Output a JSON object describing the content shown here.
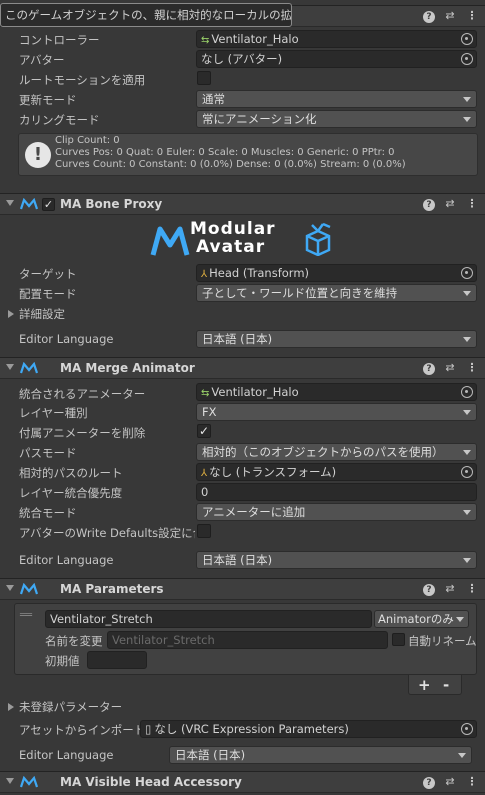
{
  "tooltip": "このゲームオブジェクトの、親に相対的なローカルの拡大縮小",
  "animator": {
    "controller_label": "コントローラー",
    "controller_value": "Ventilator_Halo",
    "avatar_label": "アバター",
    "avatar_value": "なし (アバター)",
    "root_motion_label": "ルートモーションを適用",
    "update_mode_label": "更新モード",
    "update_mode_value": "通常",
    "culling_label": "カリングモード",
    "culling_value": "常にアニメーション化",
    "info_lines": [
      "Clip Count: 0",
      "Curves Pos: 0 Quat: 0 Euler: 0 Scale: 0 Muscles: 0 Generic: 0 PPtr: 0",
      "Curves Count: 0 Constant: 0 (0.0%) Dense: 0 (0.0%) Stream: 0 (0.0%)"
    ]
  },
  "bone_proxy": {
    "title": "MA Bone Proxy",
    "logo_line1": "Modular",
    "logo_line2": "Avatar",
    "target_label": "ターゲット",
    "target_value": "Head (Transform)",
    "placement_label": "配置モード",
    "placement_value": "子として・ワールド位置と向きを維持",
    "advanced_label": "詳細設定",
    "language_label": "Editor Language",
    "language_value": "日本語 (日本)"
  },
  "merge_animator": {
    "title": "MA Merge Animator",
    "merged_label": "統合されるアニメーター",
    "merged_value": "Ventilator_Halo",
    "layer_type_label": "レイヤー種別",
    "layer_type_value": "FX",
    "delete_attached_label": "付属アニメーターを削除",
    "path_mode_label": "パスモード",
    "path_mode_value": "相対的（このオブジェクトからのパスを使用）",
    "relative_root_label": "相対的パスのルート",
    "relative_root_value": "なし (トランスフォーム)",
    "layer_priority_label": "レイヤー統合優先度",
    "layer_priority_value": "0",
    "merge_mode_label": "統合モード",
    "merge_mode_value": "アニメーターに追加",
    "write_defaults_label": "アバターのWrite Defaults設定に合",
    "language_label": "Editor Language",
    "language_value": "日本語 (日本)"
  },
  "parameters": {
    "title": "MA Parameters",
    "param_name": "Ventilator_Stretch",
    "param_type": "Animatorのみ",
    "rename_label": "名前を変更",
    "rename_placeholder": "Ventilator_Stretch",
    "auto_rename_label": "自動リネーム",
    "default_label": "初期値",
    "add_label": "+",
    "remove_label": "-",
    "unregistered_label": "未登録パラメーター",
    "import_label": "アセットからインポートする",
    "import_value": "なし (VRC Expression Parameters)",
    "language_label": "Editor Language",
    "language_value": "日本語 (日本)"
  },
  "visible_head": {
    "title": "MA Visible Head Accessory"
  },
  "colors": {
    "accent_blue": "#3fa9f5",
    "background": "#383838",
    "header": "#3e3e3e"
  }
}
